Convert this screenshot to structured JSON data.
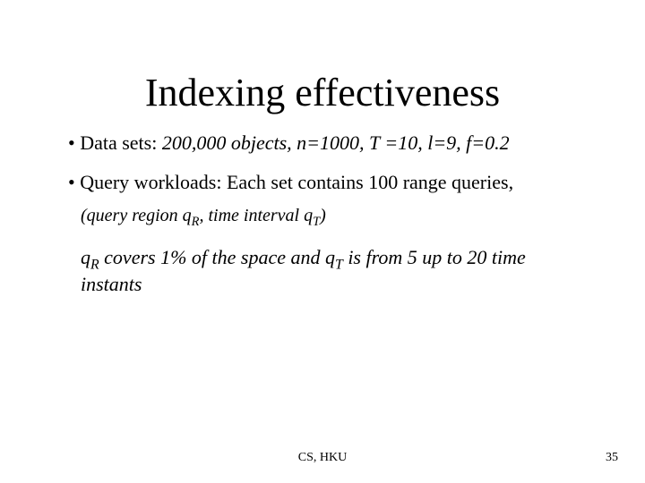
{
  "title": "Indexing effectiveness",
  "bullets": {
    "b1_label": "Data sets",
    "b1_value": "200,000 objects, n=1000, T =10, l=9, f=0.2",
    "b2_label": "Query workloads",
    "b2_value": "Each set contains 100 range queries,"
  },
  "subline": {
    "open": "(query region q",
    "sub1": "R",
    "mid": ", time interval q",
    "sub2": "T",
    "close": ")"
  },
  "para": {
    "p1": "q",
    "s1": "R",
    "p2": " covers 1% of the space and q",
    "s2": "T",
    "p3": " is from 5 up to 20 time instants"
  },
  "footer": {
    "center": "CS, HKU",
    "page": "35"
  }
}
